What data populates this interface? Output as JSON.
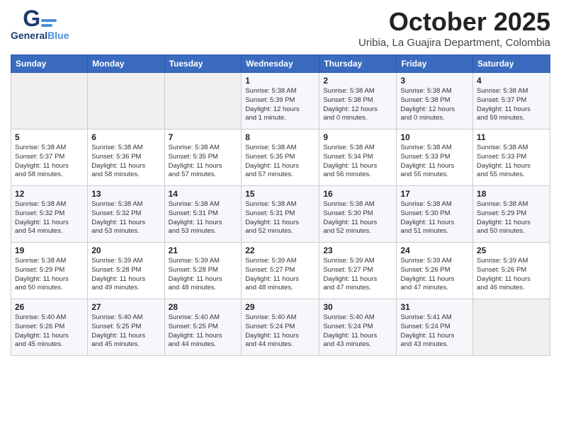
{
  "header": {
    "logo": {
      "general": "General",
      "blue": "Blue"
    },
    "month": "October 2025",
    "subtitle": "Uribia, La Guajira Department, Colombia"
  },
  "weekdays": [
    "Sunday",
    "Monday",
    "Tuesday",
    "Wednesday",
    "Thursday",
    "Friday",
    "Saturday"
  ],
  "weeks": [
    [
      {
        "day": "",
        "info": ""
      },
      {
        "day": "",
        "info": ""
      },
      {
        "day": "",
        "info": ""
      },
      {
        "day": "1",
        "info": "Sunrise: 5:38 AM\nSunset: 5:39 PM\nDaylight: 12 hours\nand 1 minute."
      },
      {
        "day": "2",
        "info": "Sunrise: 5:38 AM\nSunset: 5:38 PM\nDaylight: 12 hours\nand 0 minutes."
      },
      {
        "day": "3",
        "info": "Sunrise: 5:38 AM\nSunset: 5:38 PM\nDaylight: 12 hours\nand 0 minutes."
      },
      {
        "day": "4",
        "info": "Sunrise: 5:38 AM\nSunset: 5:37 PM\nDaylight: 11 hours\nand 59 minutes."
      }
    ],
    [
      {
        "day": "5",
        "info": "Sunrise: 5:38 AM\nSunset: 5:37 PM\nDaylight: 11 hours\nand 58 minutes."
      },
      {
        "day": "6",
        "info": "Sunrise: 5:38 AM\nSunset: 5:36 PM\nDaylight: 11 hours\nand 58 minutes."
      },
      {
        "day": "7",
        "info": "Sunrise: 5:38 AM\nSunset: 5:35 PM\nDaylight: 11 hours\nand 57 minutes."
      },
      {
        "day": "8",
        "info": "Sunrise: 5:38 AM\nSunset: 5:35 PM\nDaylight: 11 hours\nand 57 minutes."
      },
      {
        "day": "9",
        "info": "Sunrise: 5:38 AM\nSunset: 5:34 PM\nDaylight: 11 hours\nand 56 minutes."
      },
      {
        "day": "10",
        "info": "Sunrise: 5:38 AM\nSunset: 5:33 PM\nDaylight: 11 hours\nand 55 minutes."
      },
      {
        "day": "11",
        "info": "Sunrise: 5:38 AM\nSunset: 5:33 PM\nDaylight: 11 hours\nand 55 minutes."
      }
    ],
    [
      {
        "day": "12",
        "info": "Sunrise: 5:38 AM\nSunset: 5:32 PM\nDaylight: 11 hours\nand 54 minutes."
      },
      {
        "day": "13",
        "info": "Sunrise: 5:38 AM\nSunset: 5:32 PM\nDaylight: 11 hours\nand 53 minutes."
      },
      {
        "day": "14",
        "info": "Sunrise: 5:38 AM\nSunset: 5:31 PM\nDaylight: 11 hours\nand 53 minutes."
      },
      {
        "day": "15",
        "info": "Sunrise: 5:38 AM\nSunset: 5:31 PM\nDaylight: 11 hours\nand 52 minutes."
      },
      {
        "day": "16",
        "info": "Sunrise: 5:38 AM\nSunset: 5:30 PM\nDaylight: 11 hours\nand 52 minutes."
      },
      {
        "day": "17",
        "info": "Sunrise: 5:38 AM\nSunset: 5:30 PM\nDaylight: 11 hours\nand 51 minutes."
      },
      {
        "day": "18",
        "info": "Sunrise: 5:38 AM\nSunset: 5:29 PM\nDaylight: 11 hours\nand 50 minutes."
      }
    ],
    [
      {
        "day": "19",
        "info": "Sunrise: 5:38 AM\nSunset: 5:29 PM\nDaylight: 11 hours\nand 50 minutes."
      },
      {
        "day": "20",
        "info": "Sunrise: 5:39 AM\nSunset: 5:28 PM\nDaylight: 11 hours\nand 49 minutes."
      },
      {
        "day": "21",
        "info": "Sunrise: 5:39 AM\nSunset: 5:28 PM\nDaylight: 11 hours\nand 48 minutes."
      },
      {
        "day": "22",
        "info": "Sunrise: 5:39 AM\nSunset: 5:27 PM\nDaylight: 11 hours\nand 48 minutes."
      },
      {
        "day": "23",
        "info": "Sunrise: 5:39 AM\nSunset: 5:27 PM\nDaylight: 11 hours\nand 47 minutes."
      },
      {
        "day": "24",
        "info": "Sunrise: 5:39 AM\nSunset: 5:26 PM\nDaylight: 11 hours\nand 47 minutes."
      },
      {
        "day": "25",
        "info": "Sunrise: 5:39 AM\nSunset: 5:26 PM\nDaylight: 11 hours\nand 46 minutes."
      }
    ],
    [
      {
        "day": "26",
        "info": "Sunrise: 5:40 AM\nSunset: 5:26 PM\nDaylight: 11 hours\nand 45 minutes."
      },
      {
        "day": "27",
        "info": "Sunrise: 5:40 AM\nSunset: 5:25 PM\nDaylight: 11 hours\nand 45 minutes."
      },
      {
        "day": "28",
        "info": "Sunrise: 5:40 AM\nSunset: 5:25 PM\nDaylight: 11 hours\nand 44 minutes."
      },
      {
        "day": "29",
        "info": "Sunrise: 5:40 AM\nSunset: 5:24 PM\nDaylight: 11 hours\nand 44 minutes."
      },
      {
        "day": "30",
        "info": "Sunrise: 5:40 AM\nSunset: 5:24 PM\nDaylight: 11 hours\nand 43 minutes."
      },
      {
        "day": "31",
        "info": "Sunrise: 5:41 AM\nSunset: 5:24 PM\nDaylight: 11 hours\nand 43 minutes."
      },
      {
        "day": "",
        "info": ""
      }
    ]
  ]
}
